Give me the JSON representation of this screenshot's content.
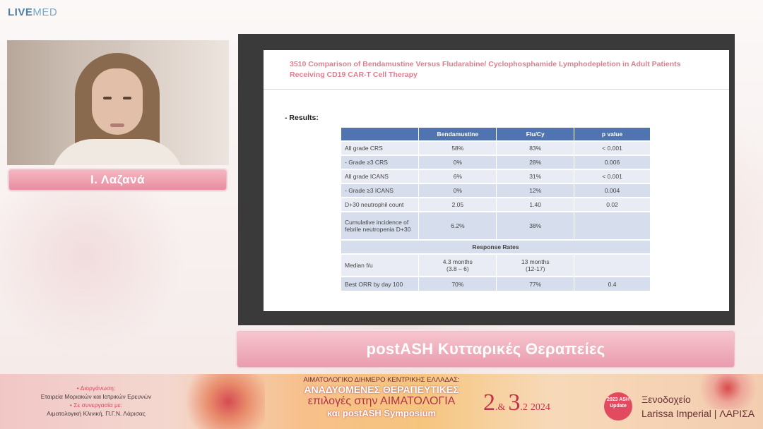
{
  "logo": {
    "live": "LIVE",
    "med": "MED"
  },
  "presenter": {
    "name": "Ι. Λαζανά"
  },
  "slide": {
    "title": "3510 Comparison of Bendamustine Versus Fludarabine/ Cyclophosphamide Lymphodepletion in Adult Patients Receiving CD19 CAR-T Cell Therapy",
    "results_label": "- Results:",
    "table": {
      "headers": [
        "",
        "Bendamustine",
        "Flu/Cy",
        "p value"
      ],
      "rows": [
        [
          "All grade CRS",
          "58%",
          "83%",
          "< 0.001"
        ],
        [
          " - Grade ≥3 CRS",
          "0%",
          "28%",
          "0.006"
        ],
        [
          "All grade ICANS",
          "6%",
          "31%",
          "< 0.001"
        ],
        [
          " - Grade ≥3 ICANS",
          "0%",
          "12%",
          "0.004"
        ],
        [
          "D+30 neutrophil count",
          "2.05",
          "1.40",
          "0.02"
        ],
        [
          "Cumulative incidence of febrile neutropenia D+30",
          "6.2%",
          "38%",
          ""
        ]
      ],
      "section_title": "Response Rates",
      "response_rows": [
        [
          "Median f/u",
          "4.3 months\n(3.8 – 6)",
          "13 months\n(12-17)",
          ""
        ],
        [
          "Best ORR by day 100",
          "70%",
          "77%",
          "0.4"
        ]
      ]
    }
  },
  "banner": {
    "title": "postASH Κυτταρικές Θεραπείες"
  },
  "event": {
    "org_line1": "• Διοργάνωση:",
    "org_line2": "Εταιρεία Μοριακών και Ιατρικών Ερευνών",
    "org_line3": "• Σε συνεργασία με:",
    "org_line4": "Αιματολογική Κλινική, Π.Γ.Ν. Λάρισας",
    "title_line1": "ΑΙΜΑΤΟΛΟΓΙΚΟ ΔΙΗΜΕΡΟ ΚΕΝΤΡΙΚΗΣ ΕΛΛΑΔΑΣ:",
    "title_line2": "ΑΝΑΔΥΟΜΕΝΕΣ ΘΕΡΑΠΕΥΤΙΚΕΣ",
    "title_line3": "επιλογές στην ΑΙΜΑΤΟΛΟΓΙΑ",
    "title_line4": "και postASH Symposium",
    "date_day1": "2",
    "date_amp": ".&",
    "date_day2": "3",
    "date_month": ".2",
    "date_year": "2024",
    "ash_badge": "2023 ASH Update",
    "venue_line1": "Ξενοδοχείο",
    "venue_line2": "Larissa Imperial | ΛΑΡΙΣΑ"
  },
  "colors": {
    "slide_title": "#e07e8e",
    "table_header": "#4f74b0",
    "name_bar": "#e88ea2",
    "logo": "#4f7fa3"
  }
}
